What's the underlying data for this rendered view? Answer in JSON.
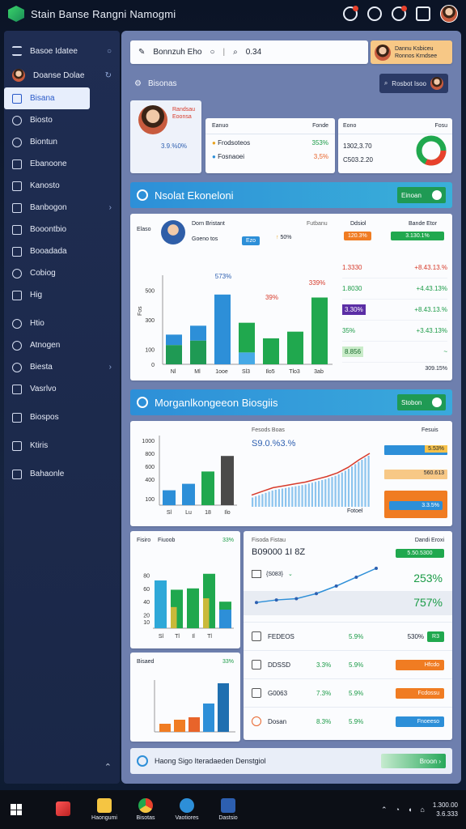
{
  "app": {
    "title": "Stain Banse Rangni Namogmi"
  },
  "sidebar": {
    "header": "Basoe Idatee",
    "profile": "Doanse Dolae",
    "items": [
      {
        "label": "Bisana",
        "active": true
      },
      {
        "label": "Biosto"
      },
      {
        "label": "Biontun"
      },
      {
        "label": "Ebanoone"
      },
      {
        "label": "Kanosto"
      },
      {
        "label": "Banbogon"
      },
      {
        "label": "Booontbio"
      },
      {
        "label": "Booadada"
      },
      {
        "label": "Cobiog"
      },
      {
        "label": "Hig"
      },
      {
        "label": "Htio"
      },
      {
        "label": "Atnogen"
      },
      {
        "label": "Biesta"
      },
      {
        "label": "Vasrlvo"
      },
      {
        "label": "Biospos"
      },
      {
        "label": "Ktiris"
      },
      {
        "label": "Bahaonle"
      }
    ]
  },
  "toolbar": {
    "title": "Bonnzuh Eho",
    "search_value": "0.34"
  },
  "profile_card": {
    "line1": "Dannu Ksbiceu",
    "line2": "Ronnos Krndsee"
  },
  "section": {
    "title": "Bisonas",
    "pill_label": "Rosbot Isoo"
  },
  "summary": {
    "person_name": "Randsau",
    "person_sub": "Eoonsa",
    "person_pct": "3.9.%0%",
    "table": {
      "h1": "Eanuo",
      "h2": "Fonde",
      "rows": [
        {
          "label": "Frodsoteos",
          "value": "353%"
        },
        {
          "label": "Fosnaoei",
          "value": "3,5%"
        }
      ]
    },
    "right": {
      "h1": "Eono",
      "h2": "Fosu",
      "v1": "1302,3.70",
      "v2": "C503.2.20"
    }
  },
  "banner1": {
    "title": "Nsolat Ekoneloni",
    "button": "Einoan"
  },
  "panel2": {
    "left_head": "Elaso",
    "person_name": "Dorn Bristant",
    "person_sub": "Goeno tos",
    "badge": "Ezo",
    "mid_pct": "50%",
    "mid_label": "Futbanu",
    "right_h1": "Ddsiol",
    "right_h2": "Bande Etor",
    "tag1": "120.3%",
    "tag2": "3.130.1%",
    "y_label": "Fos",
    "chart_labels": {
      "top_a": "573%",
      "top_b": "39%",
      "top_c": "339%"
    },
    "rows": [
      {
        "l": "1.3330",
        "r": "+8.43.13.%"
      },
      {
        "l": "1.8030",
        "r": "+4.43.13%"
      },
      {
        "l": "3.30%",
        "r": "+8.43.13.%"
      },
      {
        "l": "35%",
        "r": "+3.43.13%"
      },
      {
        "l": "8.856",
        "r": "~"
      }
    ],
    "foot": "309.15%"
  },
  "banner2": {
    "title": "Morganlkongeeon Biosgiis",
    "button": "Stobon"
  },
  "panel3": {
    "line_title": "Fesods Boas",
    "line_value": "S9.0.%3.%",
    "line_axis": "Fotoel",
    "bar_axis": "Fesuis",
    "tags": [
      "5.53%",
      "560.613",
      "3.3.5%"
    ]
  },
  "panel4": {
    "h_left": "Fisiro",
    "h_right": "Fiuoob",
    "top_value": "33%",
    "mini_label": "Bisaed",
    "mini_value": "33%",
    "chart_title": "Fisoda Fistau",
    "chart_value": "B09000 1I 8Z",
    "chart_right_head": "Dandi Eroxi",
    "chart_tag": "5.50.5300",
    "pct_a": "253%",
    "pct_b": "757%",
    "dropdown": "{S083}",
    "rows": [
      {
        "label": "FEDEOS",
        "a": "",
        "b": "5.9%",
        "c": "530%",
        "tag": "R3"
      },
      {
        "label": "DDSSD",
        "a": "3.3%",
        "b": "5.9%",
        "tag": "Hfcdo"
      },
      {
        "label": "G0063",
        "a": "7.3%",
        "b": "5.9%",
        "tag": "Fcdossu"
      },
      {
        "label": "Dosan",
        "a": "8.3%",
        "b": "5.9%",
        "tag": "Fnoeeso"
      }
    ]
  },
  "footer": {
    "text": "Haong Sigo Iteradaeden Denstgiol",
    "button": "Broon"
  },
  "taskbar": {
    "apps": [
      "",
      "Haongumi",
      "Bisotas",
      "Vaotiores",
      "Dastsio"
    ],
    "clock_time": "1.300.00",
    "clock_date": "3.6.333"
  },
  "chart_data": [
    {
      "type": "bar",
      "name": "bar-panel-2",
      "ylim": [
        0,
        600
      ],
      "categories": [
        "Nl",
        "Ml",
        "1ooe",
        "Sl3",
        "Ilo5",
        "Tlo3",
        "3ab"
      ],
      "series": [
        {
          "values": [
            130,
            160,
            0,
            0,
            0,
            0,
            0
          ],
          "color": "#1f9a54"
        },
        {
          "values": [
            70,
            100,
            470,
            80,
            0,
            0,
            0
          ],
          "color": "#2d8fd8"
        },
        {
          "values": [
            0,
            0,
            0,
            200,
            175,
            220,
            450
          ],
          "color": "#20a84e"
        }
      ],
      "ticks": [
        0,
        100,
        300,
        500
      ]
    },
    {
      "type": "bar",
      "name": "bar-panel-3",
      "ylim": [
        0,
        1000
      ],
      "categories": [
        "Sl",
        "Lu",
        "18",
        "Ilo"
      ],
      "values": [
        230,
        330,
        520,
        760
      ],
      "colors": [
        "#2d8fd8",
        "#2d8fd8",
        "#20a84e",
        "#4a4a4a"
      ],
      "ticks": [
        100,
        400,
        600,
        800,
        1000
      ]
    },
    {
      "type": "area",
      "name": "line-panel-3",
      "values": [
        10,
        14,
        18,
        20,
        22,
        24,
        27,
        30,
        34,
        40,
        48,
        55
      ]
    },
    {
      "type": "bar",
      "name": "bar-panel-4",
      "categories": [
        "Sl",
        "Tl",
        "Il",
        "Tl"
      ],
      "values": [
        72,
        58,
        60,
        82,
        40
      ],
      "ylim": [
        0,
        100
      ],
      "ticks": [
        10,
        20,
        40,
        60,
        80
      ]
    },
    {
      "type": "bar",
      "name": "mini-bar",
      "values": [
        10,
        15,
        18,
        35,
        60
      ],
      "colors": [
        "#f07c22",
        "#f07c22",
        "#e8642a",
        "#2d8fd8",
        "#1f6fb0"
      ]
    },
    {
      "type": "line",
      "name": "line-panel-4",
      "values": [
        10,
        14,
        16,
        24,
        36,
        50,
        64
      ]
    }
  ]
}
